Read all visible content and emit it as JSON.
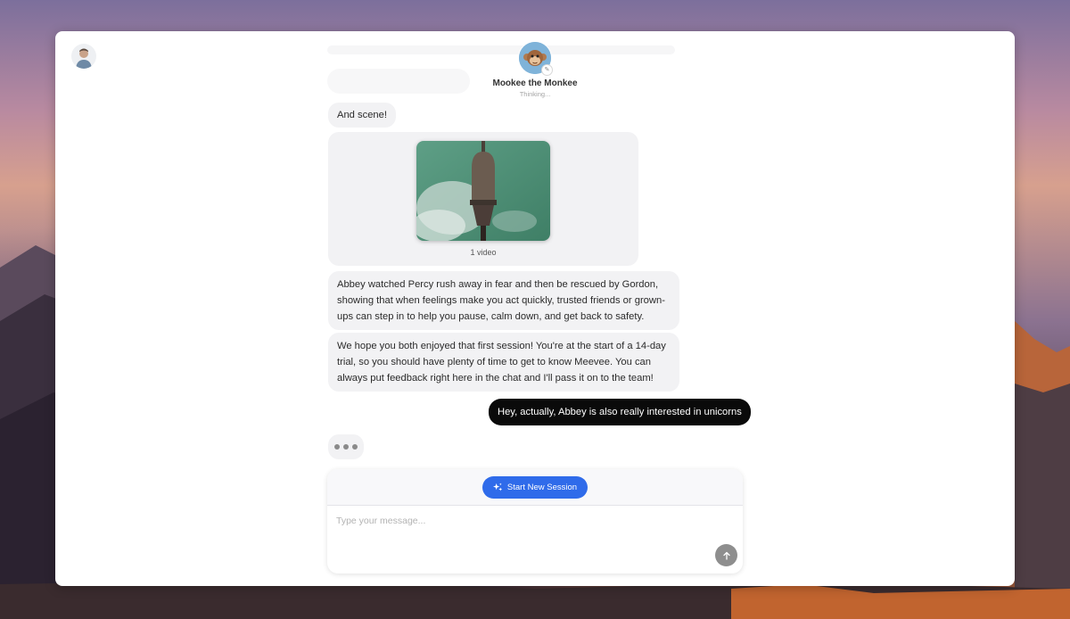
{
  "header": {
    "bot_name": "Mookee the Monkee",
    "bot_status": "Thinking..."
  },
  "messages": [
    {
      "role": "bot",
      "text": "And scene!"
    },
    {
      "role": "bot",
      "type": "video",
      "caption": "1 video"
    },
    {
      "role": "bot",
      "text": "Abbey watched Percy rush away in fear and then be rescued by Gordon, showing that when feelings make you act quickly, trusted friends or grown-ups can step in to help you pause, calm down, and get back to safety."
    },
    {
      "role": "bot",
      "text": "We hope you both enjoyed that first session! You're at the start of a 14-day trial, so you should have plenty of time to get to know Meevee. You can always put feedback right here in the chat and I'll pass it on to the team!"
    },
    {
      "role": "user",
      "text": "Hey, actually, Abbey is also really interested in unicorns"
    }
  ],
  "composer": {
    "start_label": "Start New Session",
    "placeholder": "Type your message..."
  },
  "colors": {
    "accent": "#2f6bea",
    "user_bubble": "#0a0a0a",
    "bot_bubble": "#f2f2f4"
  },
  "icons": {
    "start_session": "sparkles-icon",
    "send": "arrow-up-icon"
  }
}
